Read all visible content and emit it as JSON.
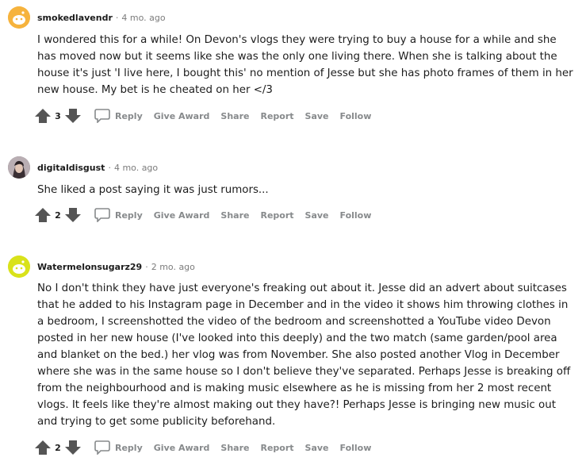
{
  "comments": [
    {
      "username": "smokedlavendr",
      "time": "4 mo. ago",
      "avatar_color": "#f6b33d",
      "text": "I wondered this for a while! On Devon's vlogs they were trying to buy a house for a while and she has moved now but it seems like she was the only one living there. When she is talking about the house it's just 'I live here, I bought this' no mention of Jesse but she has photo frames of them in her new house. My bet is he cheated on her </3",
      "score": "3",
      "actions": {
        "reply": "Reply",
        "award": "Give Award",
        "share": "Share",
        "report": "Report",
        "save": "Save",
        "follow": "Follow"
      }
    },
    {
      "username": "digitaldisgust",
      "time": "4 mo. ago",
      "avatar_color": "#8a7f86",
      "text": "She liked a post saying it was just rumors...",
      "score": "2",
      "actions": {
        "reply": "Reply",
        "award": "Give Award",
        "share": "Share",
        "report": "Report",
        "save": "Save",
        "follow": "Follow"
      }
    },
    {
      "username": "Watermelonsugarz29",
      "time": "2 mo. ago",
      "avatar_color": "#d9e21b",
      "text": "No I don't think they have just everyone's freaking out about it. Jesse did an advert about suitcases that he added to his Instagram page in December and in the video it shows him throwing clothes in a bedroom, I screenshotted the video of the bedroom and screenshotted a YouTube video Devon posted in her new house (I've looked into this deeply) and the two match (same garden/pool area and blanket on the bed.) her vlog was from November. She also posted another Vlog in December where she was in the same house so I don't believe they've separated. Perhaps Jesse is breaking off from the neighbourhood and is making music elsewhere as he is missing from her 2 most recent vlogs. It feels like they're almost making out they have?! Perhaps Jesse is bringing new music out and trying to get some publicity beforehand.",
      "score": "2",
      "actions": {
        "reply": "Reply",
        "award": "Give Award",
        "share": "Share",
        "report": "Report",
        "save": "Save",
        "follow": "Follow"
      }
    }
  ]
}
